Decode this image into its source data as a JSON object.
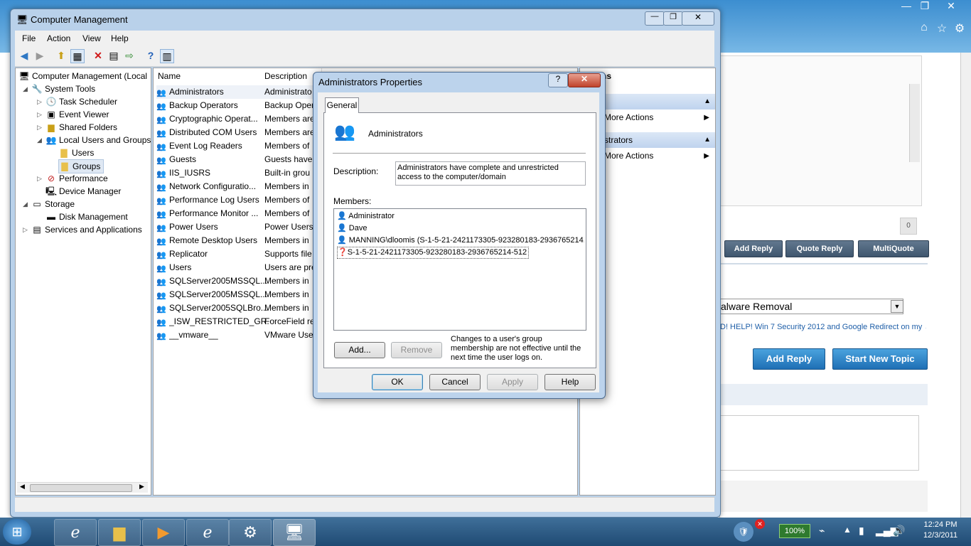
{
  "colors": {
    "titlebar": "#b9d1ea",
    "taskbar": "#1f4a73",
    "accent": "#3c7fb1"
  },
  "browser": {
    "window_controls": [
      "—",
      "❐",
      "✕"
    ],
    "reply_count": "0",
    "buttons": {
      "add_reply": "Add Reply",
      "quote_reply": "Quote Reply",
      "multiquote": "MultiQuote"
    },
    "forum_select": "alware Removal",
    "topic_link": "D! HELP! Win 7 Security 2012 and Google Redirect on my →",
    "big_buttons": {
      "add_reply": "Add Reply",
      "start_new_topic": "Start New Topic"
    }
  },
  "cm": {
    "title": "Computer Management",
    "menu": [
      "File",
      "Action",
      "View",
      "Help"
    ],
    "tree": [
      {
        "label": "Computer Management (Local",
        "icon": "computer-icon"
      },
      {
        "label": "System Tools",
        "icon": "tools-icon"
      },
      {
        "label": "Task Scheduler",
        "icon": "clock-icon"
      },
      {
        "label": "Event Viewer",
        "icon": "event-icon"
      },
      {
        "label": "Shared Folders",
        "icon": "shared-folder-icon"
      },
      {
        "label": "Local Users and Groups",
        "icon": "users-icon"
      },
      {
        "label": "Users",
        "icon": "folder-icon"
      },
      {
        "label": "Groups",
        "icon": "folder-icon"
      },
      {
        "label": "Performance",
        "icon": "performance-icon"
      },
      {
        "label": "Device Manager",
        "icon": "device-icon"
      },
      {
        "label": "Storage",
        "icon": "storage-icon"
      },
      {
        "label": "Disk Management",
        "icon": "disk-icon"
      },
      {
        "label": "Services and Applications",
        "icon": "services-icon"
      }
    ],
    "list_headers": {
      "name": "Name",
      "description": "Description"
    },
    "list": [
      {
        "name": "Administrators",
        "desc": "Administrato"
      },
      {
        "name": "Backup Operators",
        "desc": "Backup Oper"
      },
      {
        "name": "Cryptographic Operat...",
        "desc": "Members are"
      },
      {
        "name": "Distributed COM Users",
        "desc": "Members are"
      },
      {
        "name": "Event Log Readers",
        "desc": "Members of"
      },
      {
        "name": "Guests",
        "desc": "Guests have"
      },
      {
        "name": "IIS_IUSRS",
        "desc": "Built-in grou"
      },
      {
        "name": "Network Configuratio...",
        "desc": "Members in"
      },
      {
        "name": "Performance Log Users",
        "desc": "Members of"
      },
      {
        "name": "Performance Monitor ...",
        "desc": "Members of"
      },
      {
        "name": "Power Users",
        "desc": "Power Users"
      },
      {
        "name": "Remote Desktop Users",
        "desc": "Members in"
      },
      {
        "name": "Replicator",
        "desc": "Supports file"
      },
      {
        "name": "Users",
        "desc": "Users are pre"
      },
      {
        "name": "SQLServer2005MSSQL...",
        "desc": "Members in"
      },
      {
        "name": "SQLServer2005MSSQL...",
        "desc": "Members in"
      },
      {
        "name": "SQLServer2005SQLBro...",
        "desc": "Members in"
      },
      {
        "name": "_ISW_RESTRICTED_GR...",
        "desc": "ForceField re"
      },
      {
        "name": "__vmware__",
        "desc": "VMware User"
      }
    ],
    "actions": {
      "header": "ns",
      "section1": "s",
      "more1": "More Actions",
      "section2": "inistrators",
      "more2": "More Actions"
    }
  },
  "dialog": {
    "title": "Administrators Properties",
    "help_btn": "?",
    "close_btn": "✕",
    "tab": "General",
    "group_name": "Administrators",
    "description_label": "Description:",
    "description": "Administrators have complete and unrestricted access to the computer/domain",
    "members_label": "Members:",
    "members": [
      "Administrator",
      "Dave",
      "MANNING\\dloomis (S-1-5-21-2421173305-923280183-2936765214...",
      "S-1-5-21-2421173305-923280183-2936765214-512"
    ],
    "add": "Add...",
    "remove": "Remove",
    "note": "Changes to a user's group membership are not effective until the next time the user logs on.",
    "ok": "OK",
    "cancel": "Cancel",
    "apply": "Apply",
    "help": "Help"
  },
  "taskbar": {
    "battery": "100%",
    "time": "12:24 PM",
    "date": "12/3/2011"
  }
}
